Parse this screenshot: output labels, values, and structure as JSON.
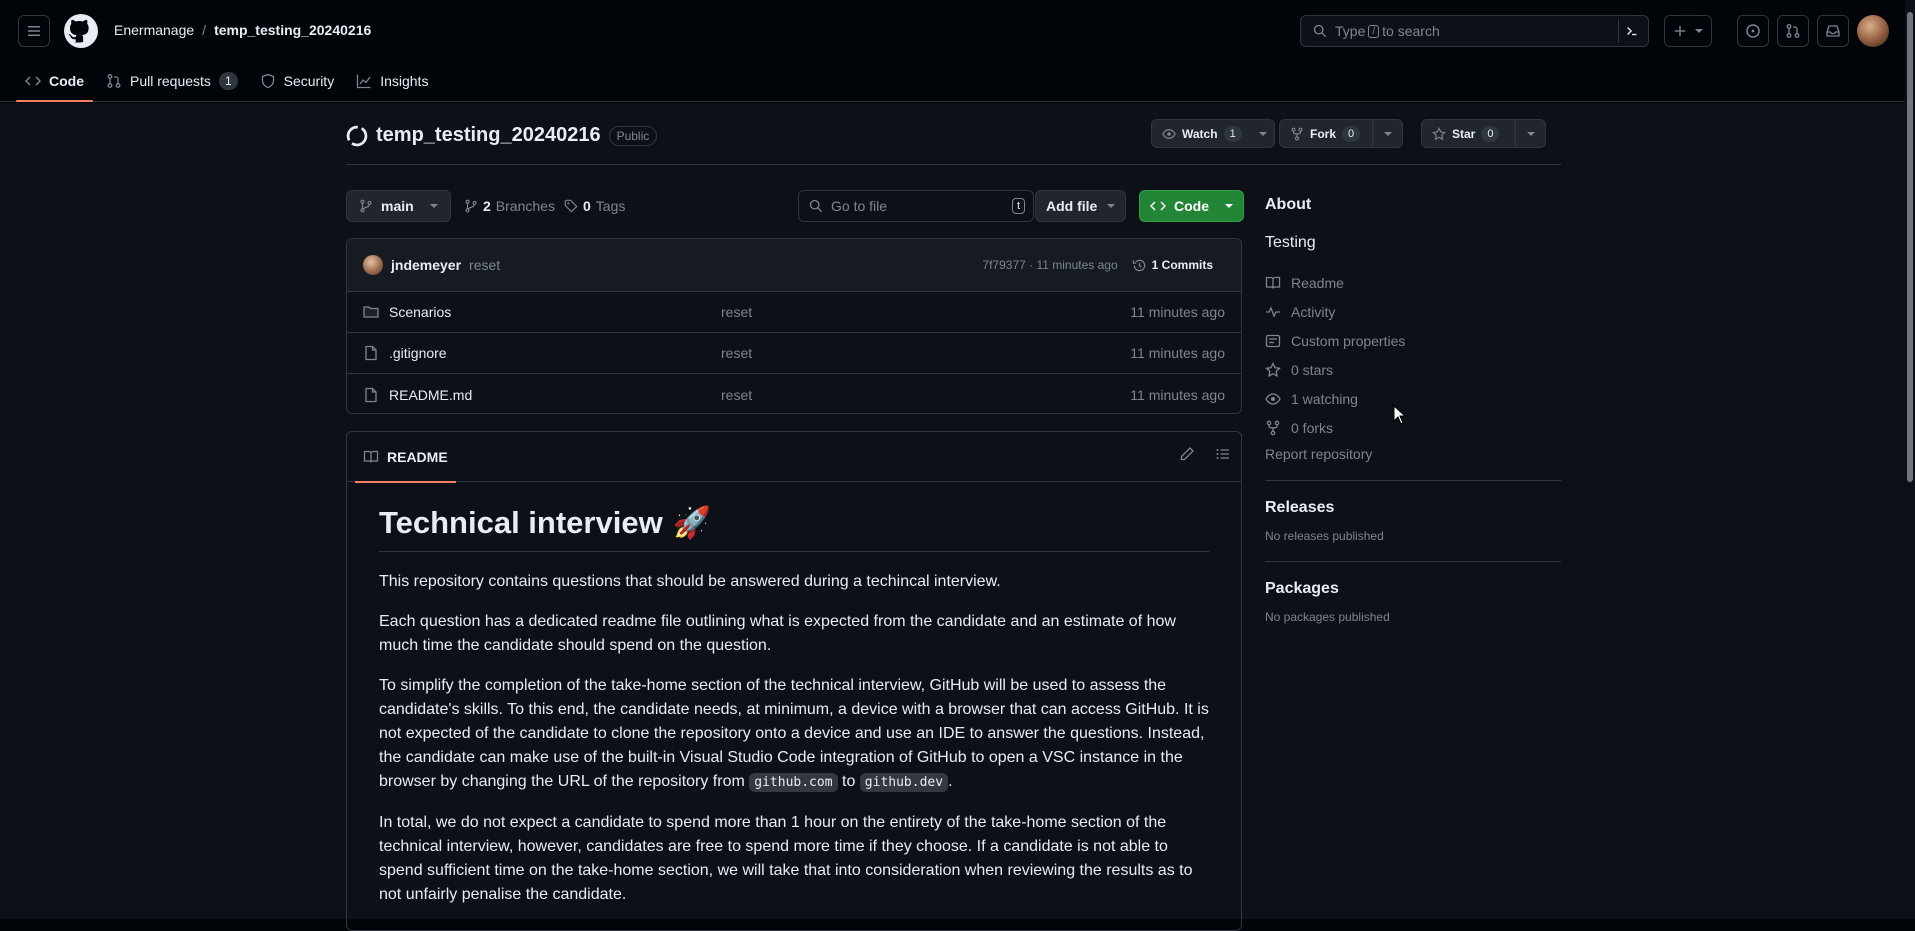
{
  "header": {
    "owner": "Enermanage",
    "separator": "/",
    "repo": "temp_testing_20240216",
    "search_prefix": "Type",
    "search_key": "/",
    "search_suffix": "to search"
  },
  "repo_nav": {
    "code": "Code",
    "pull_requests": "Pull requests",
    "pull_requests_count": "1",
    "security": "Security",
    "insights": "Insights"
  },
  "repo": {
    "name": "temp_testing_20240216",
    "visibility": "Public",
    "watch_label": "Watch",
    "watch_count": "1",
    "fork_label": "Fork",
    "fork_count": "0",
    "star_label": "Star",
    "star_count": "0"
  },
  "toolbar": {
    "branch": "main",
    "branches_count": "2",
    "branches_label": "Branches",
    "tags_count": "0",
    "tags_label": "Tags",
    "goto_placeholder": "Go to file",
    "goto_key": "t",
    "add_file": "Add file",
    "code": "Code"
  },
  "commit": {
    "author": "jndemeyer",
    "message": "reset",
    "meta": "7f79377 · 11 minutes ago",
    "commits_label": "1 Commits"
  },
  "files": [
    {
      "name": "Scenarios",
      "type": "folder",
      "message": "reset",
      "time": "11 minutes ago"
    },
    {
      "name": ".gitignore",
      "type": "file",
      "message": "reset",
      "time": "11 minutes ago"
    },
    {
      "name": "README.md",
      "type": "file",
      "message": "reset",
      "time": "11 minutes ago"
    }
  ],
  "readme": {
    "tab_label": "README",
    "heading": "Technical interview",
    "heading_emoji": "🚀",
    "p1": "This repository contains questions that should be answered during a techincal interview.",
    "p2": "Each question has a dedicated readme file outlining what is expected from the candidate and an estimate of how much time the candidate should spend on the question.",
    "p3_a": "To simplify the completion of the take-home section of the technical interview, GitHub will be used to assess the candidate's skills. To this end, the candidate needs, at minimum, a device with a browser that can access GitHub. It is not expected of the candidate to clone the repository onto a device and use an IDE to answer the questions. Instead, the candidate can make use of the built-in Visual Studio Code integration of GitHub to open a VSC instance in the browser by changing the URL of the repository from",
    "p3_code1": "github.com",
    "p3_to": "to",
    "p3_code2": "github.dev",
    "p3_end": ".",
    "p4": "In total, we do not expect a candidate to spend more than 1 hour on the entirety of the take-home section of the technical interview, however, candidates are free to spend more time if they choose. If a candidate is not able to spend sufficient time on the take-home section, we will take that into consideration when reviewing the results as to not unfairly penalise the candidate."
  },
  "about": {
    "title": "About",
    "description": "Testing",
    "items": [
      {
        "icon": "book-icon",
        "label": "Readme"
      },
      {
        "icon": "pulse-icon",
        "label": "Activity"
      },
      {
        "icon": "note-icon",
        "label": "Custom properties"
      },
      {
        "icon": "star-icon",
        "label": "0 stars"
      },
      {
        "icon": "eye-icon",
        "label": "1 watching"
      },
      {
        "icon": "fork-icon",
        "label": "0 forks"
      }
    ],
    "report": "Report repository"
  },
  "releases": {
    "title": "Releases",
    "empty": "No releases published"
  },
  "packages": {
    "title": "Packages",
    "empty": "No packages published"
  },
  "colors": {
    "accent_underline": "#f78166",
    "code_button": "#238636",
    "bg": "#0d1117",
    "header_bg": "#010409"
  }
}
